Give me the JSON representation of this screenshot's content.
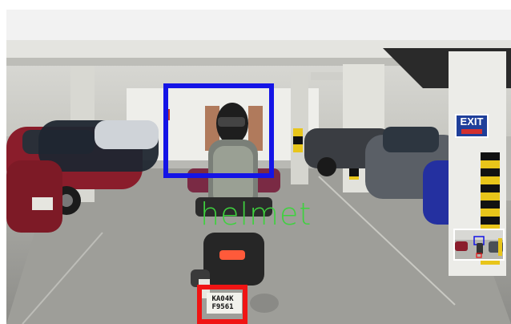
{
  "detections": {
    "helmet_label": "helmet",
    "helmet_box_color": "#1414e6",
    "plate_box_color": "#f01414",
    "label_color": "#3fd13f"
  },
  "license_plate": {
    "line1": "KA04K",
    "line2": "F9561"
  },
  "signage": {
    "exit_text": "EXIT"
  }
}
